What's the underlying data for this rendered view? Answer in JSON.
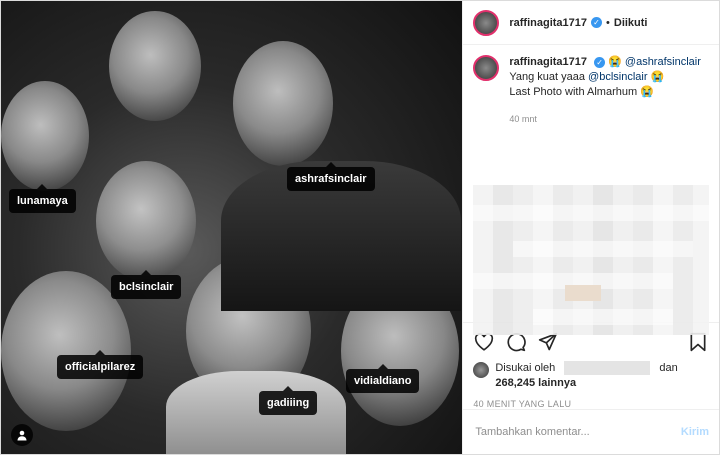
{
  "post": {
    "username": "raffinagita1717",
    "follow_status": "Diikuti",
    "caption": {
      "username": "raffinagita1717",
      "mention_main": "@ashrafsinclair",
      "line1_prefix": "Yang kuat yaaa ",
      "line1_mention": "@bclsinclair",
      "line2": "Last Photo with Almarhum"
    },
    "comment_time": "40 mnt",
    "tags": [
      {
        "label": "lunamaya"
      },
      {
        "label": "ashrafsinclair"
      },
      {
        "label": "bclsinclair"
      },
      {
        "label": "officialpilarez"
      },
      {
        "label": "gadiiing"
      },
      {
        "label": "vidialdiano"
      }
    ],
    "likes": {
      "prefix": "Disukai oleh",
      "and": "dan",
      "count": "268,245 lainnya"
    },
    "posted_ago": "40 MENIT YANG LALU",
    "comment_placeholder": "Tambahkan komentar...",
    "send_label": "Kirim"
  },
  "icons": {
    "heart": "heart-icon",
    "comment": "comment-icon",
    "share": "share-icon",
    "bookmark": "bookmark-icon",
    "verified": "verified-badge-icon",
    "user_tags": "user-tags-icon"
  },
  "colors": {
    "verified": "#3897f0",
    "mention": "#003569",
    "send_disabled": "#b3dbff",
    "story_ring": "#e1306c"
  }
}
